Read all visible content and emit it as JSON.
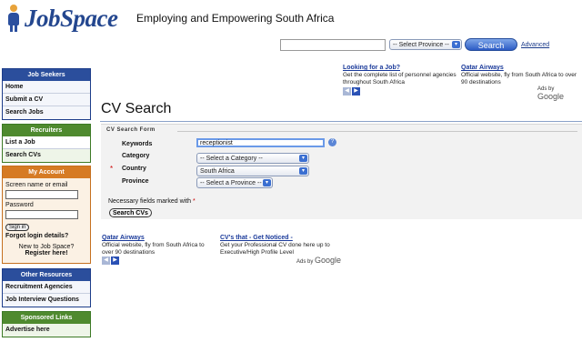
{
  "header": {
    "logo_text": "JobSpace",
    "tagline": "Employing and Empowering South Africa"
  },
  "top_search": {
    "input_value": "",
    "province_select": "-- Select Province --",
    "search_button": "Search",
    "advanced_link": "Advanced"
  },
  "sidebar": {
    "job_seekers": {
      "title": "Job Seekers",
      "items": [
        "Home",
        "Submit a CV",
        "Search Jobs"
      ]
    },
    "recruiters": {
      "title": "Recruiters",
      "items": [
        "List a Job",
        "Search CVs"
      ]
    },
    "account": {
      "title": "My Account",
      "username_label": "Screen name or email",
      "password_label": "Password",
      "signin_button": "Sign in",
      "forgot": "Forgot login details?",
      "new_prompt": "New to Job Space?",
      "register": "Register here!"
    },
    "other_resources": {
      "title": "Other Resources",
      "items": [
        "Recruitment Agencies",
        "Job Interview Questions"
      ]
    },
    "sponsored": {
      "title": "Sponsored Links",
      "items": [
        "Advertise here"
      ]
    }
  },
  "ads_top": [
    {
      "title": "Looking for a Job?",
      "text": "Get the complete list of personnel agencies throughout South Africa"
    },
    {
      "title": "Qatar Airways",
      "text": "Official website, fly from South Africa to over 90 destinations"
    }
  ],
  "ads_bottom": [
    {
      "title": "Qatar Airways",
      "text": "Official website, fly from South Africa to over 90 destinations"
    },
    {
      "title": "CV's that - Get Noticed -",
      "text": "Get your Professional CV done here up to Executive/High Profile Level"
    }
  ],
  "ads_by": "Ads by",
  "ads_brand": "Google",
  "page_title": "CV Search",
  "form": {
    "title": "CV Search Form",
    "keywords_label": "Keywords",
    "keywords_value": "receptionist",
    "category_label": "Category",
    "category_value": "-- Select a Category --",
    "country_label": "Country",
    "country_value": "South Africa",
    "province_label": "Province",
    "province_value": "-- Select a Province --",
    "required_note": "Necessary fields marked with",
    "required_mark": "*",
    "submit": "Search CVs"
  },
  "colors": {
    "brand_blue": "#24478f",
    "box_blue": "#2b4e9c",
    "box_green": "#4f8a2f",
    "box_orange": "#d67b24",
    "required_red": "#cc0000"
  }
}
